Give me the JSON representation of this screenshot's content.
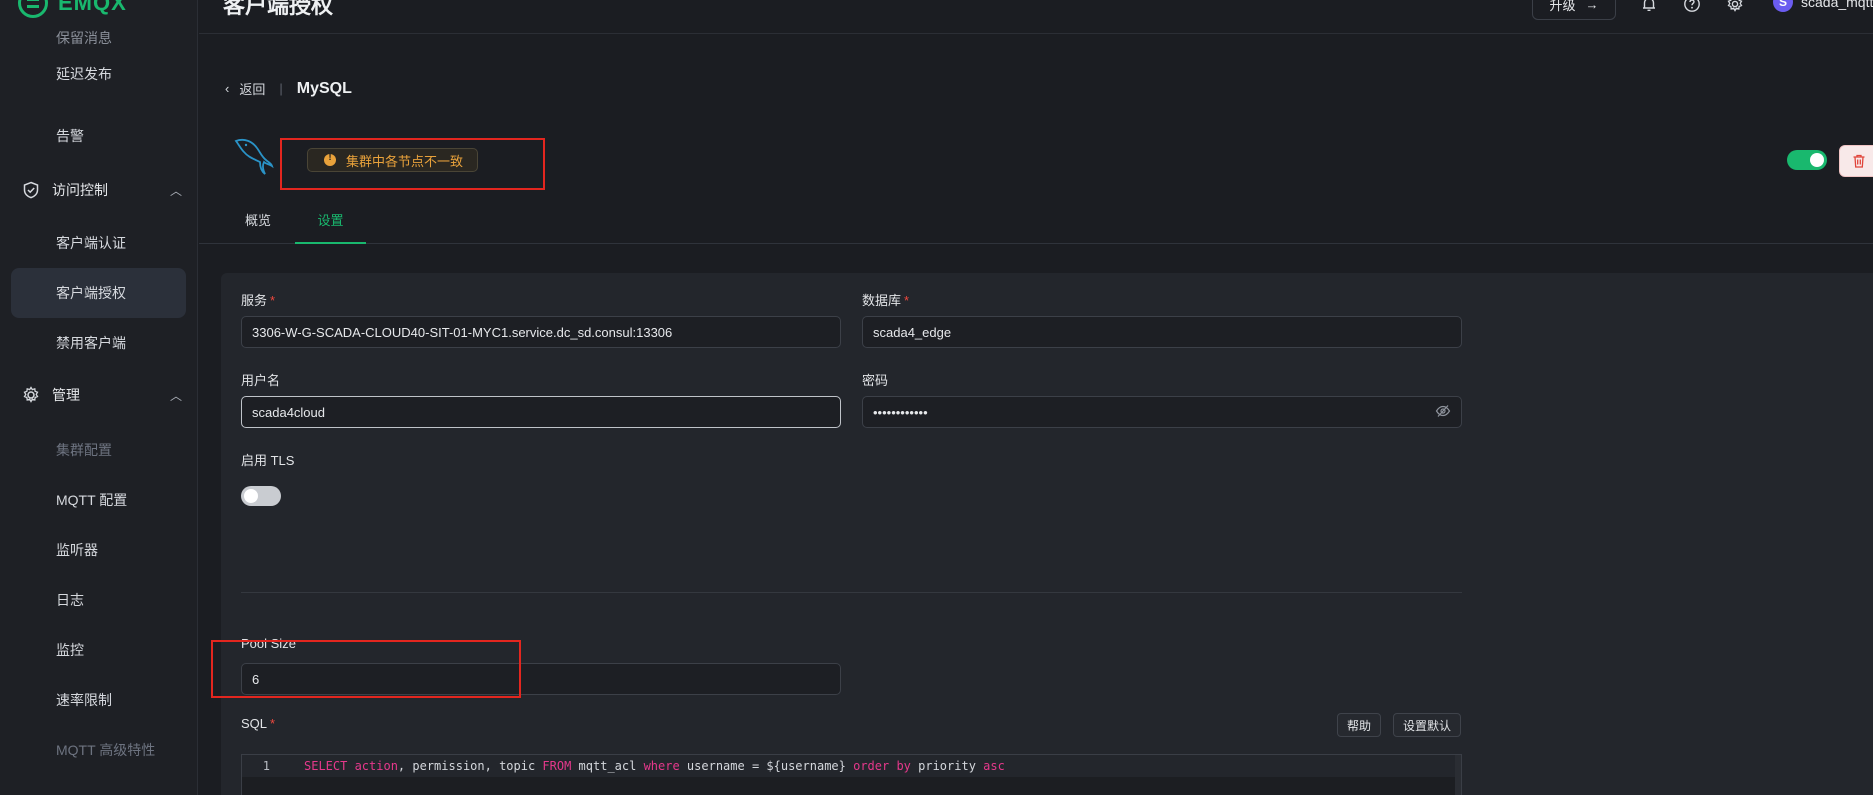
{
  "app": {
    "brand": "EMQX"
  },
  "sidebar": {
    "cut_item": "保留消息",
    "items": [
      {
        "label": "延迟发布"
      },
      {
        "label": "告警"
      }
    ],
    "groups": [
      {
        "label": "访问控制",
        "icon": "shield-icon",
        "expanded": true
      },
      {
        "label": "管理",
        "icon": "gear-cog-icon",
        "expanded": true
      }
    ],
    "access_items": [
      {
        "label": "客户端认证"
      },
      {
        "label": "客户端授权",
        "active": true
      },
      {
        "label": "禁用客户端"
      }
    ],
    "manage_items": [
      {
        "label": "集群配置",
        "disabled": true
      },
      {
        "label": "MQTT 配置"
      },
      {
        "label": "监听器"
      },
      {
        "label": "日志"
      },
      {
        "label": "监控"
      },
      {
        "label": "速率限制"
      },
      {
        "label": "MQTT 高级特性",
        "disabled": true
      }
    ]
  },
  "header": {
    "title": "客户端授权",
    "upgrade_label": "升级",
    "user_initial": "S",
    "user_name": "scada_mqtt"
  },
  "breadcrumb": {
    "back_label": "返回",
    "title": "MySQL"
  },
  "status": {
    "warning": "集群中各节点不一致",
    "enabled": true
  },
  "tabs": [
    {
      "label": "概览",
      "active": false
    },
    {
      "label": "设置",
      "active": true
    }
  ],
  "form": {
    "server": {
      "label": "服务",
      "required": "*",
      "value": "3306-W-G-SCADA-CLOUD40-SIT-01-MYC1.service.dc_sd.consul:13306"
    },
    "database": {
      "label": "数据库",
      "required": "*",
      "value": "scada4_edge"
    },
    "username": {
      "label": "用户名",
      "value": "scada4cloud"
    },
    "password": {
      "label": "密码",
      "value": "••••••••••••"
    },
    "tls": {
      "label": "启用 TLS",
      "enabled": false
    },
    "pool_size": {
      "label": "Pool Size",
      "value": "6"
    },
    "sql": {
      "label": "SQL",
      "required": "*",
      "help_label": "帮助",
      "default_label": "设置默认",
      "line_number": "1",
      "code": "SELECT action, permission, topic FROM mqtt_acl where username = ${username} order by priority asc"
    }
  },
  "colors": {
    "accent": "#19b86e",
    "warning": "#e9a23b",
    "danger": "#e3261f"
  }
}
